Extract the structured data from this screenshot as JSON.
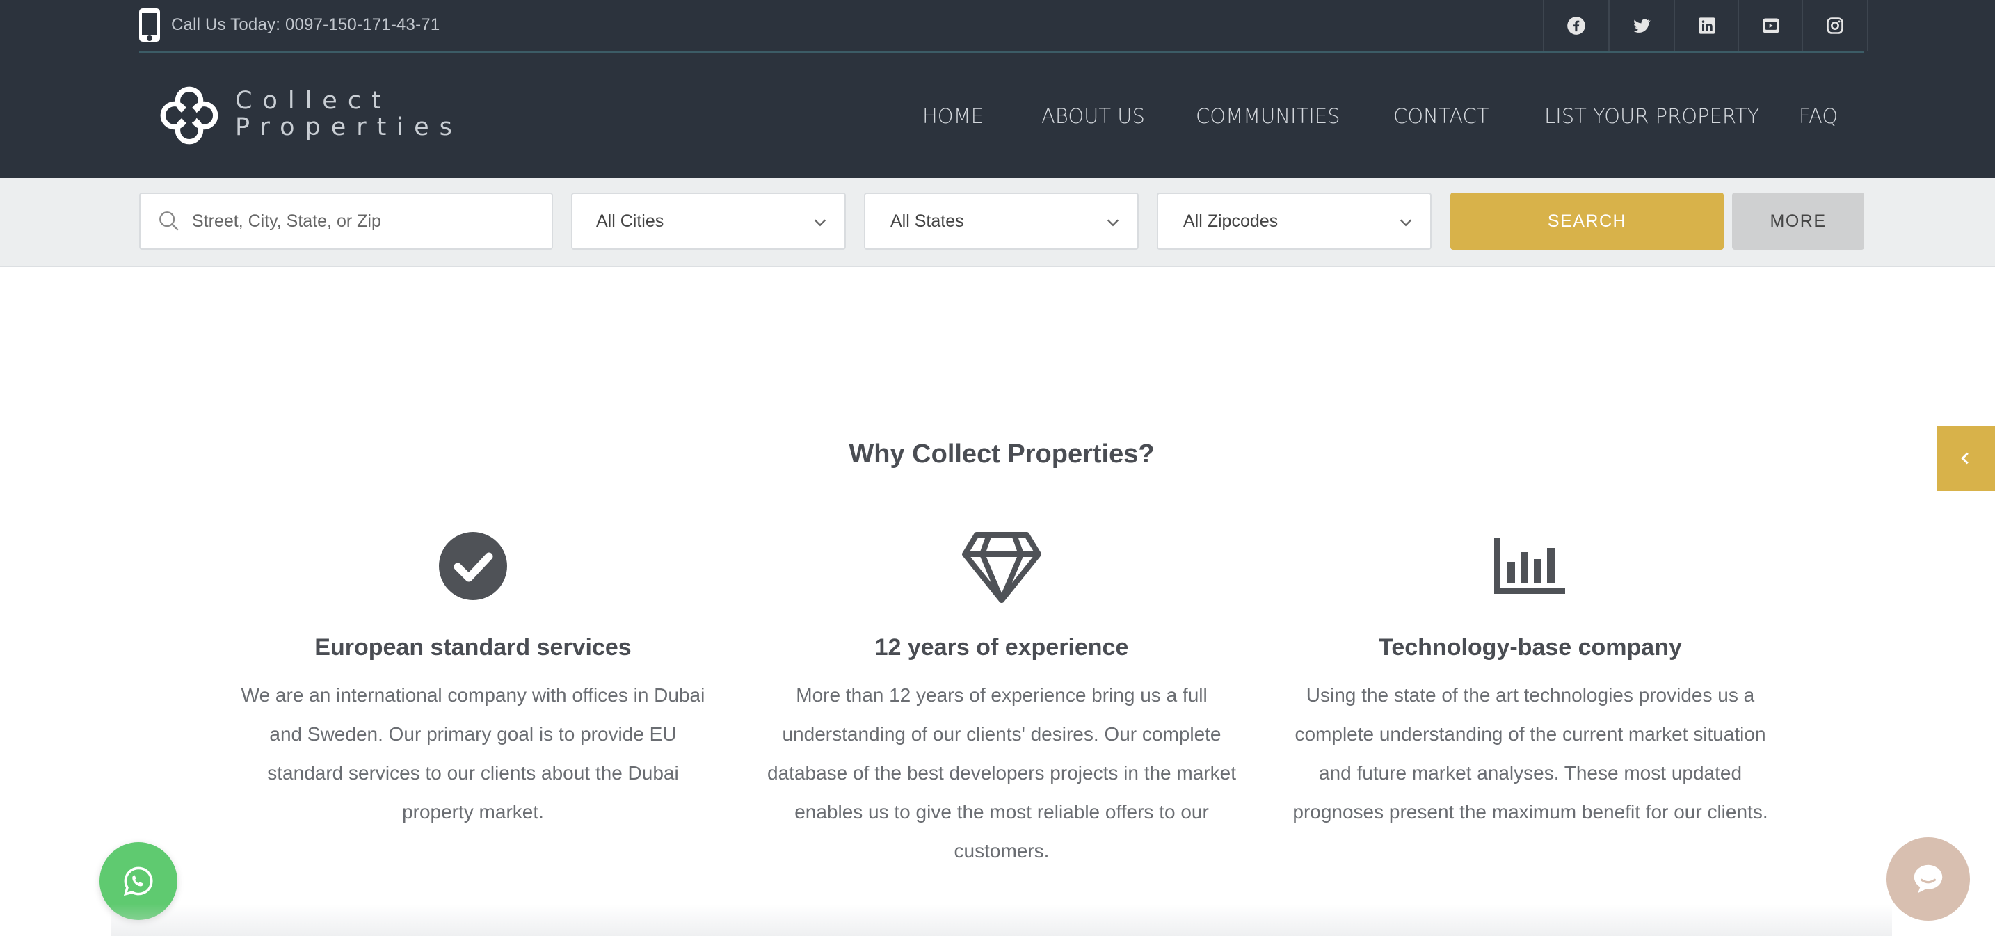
{
  "topbar": {
    "call_text": "Call Us Today: 0097-150-171-43-71",
    "phone_icon": "mobile-phone-icon",
    "social": [
      {
        "name": "facebook-icon"
      },
      {
        "name": "twitter-icon"
      },
      {
        "name": "linkedin-icon"
      },
      {
        "name": "youtube-icon"
      },
      {
        "name": "instagram-icon"
      }
    ]
  },
  "brand": {
    "line1": "Collect",
    "line2": "Properties"
  },
  "nav": {
    "items": [
      "HOME",
      "ABOUT US",
      "COMMUNITIES",
      "CONTACT",
      "LIST YOUR PROPERTY",
      "FAQ"
    ]
  },
  "search": {
    "placeholder": "Street, City, State, or Zip",
    "city_select": "All Cities",
    "state_select": "All States",
    "zip_select": "All Zipcodes",
    "search_button": "SEARCH",
    "more_button": "MORE"
  },
  "section": {
    "title": "Why Collect Properties?",
    "features": [
      {
        "icon": "check-circle-icon",
        "title": "European standard services",
        "text": "We are an international company with offices in Dubai and Sweden. Our primary goal is to provide EU standard services to our clients about the Dubai property market."
      },
      {
        "icon": "diamond-icon",
        "title": "12 years of experience",
        "text": "More than 12 years of experience bring us a full understanding of our clients' desires. Our complete database of the best developers projects in the market enables us to give the most reliable offers to our customers."
      },
      {
        "icon": "bar-chart-icon",
        "title": "Technology-base company",
        "text": "Using the state of the art technologies provides us a complete understanding of the current market situation and future market analyses. These most updated prognoses present the maximum benefit for our clients."
      }
    ]
  },
  "colors": {
    "header_bg": "#2c333d",
    "accent": "#d8b24a",
    "whatsapp": "#5fca70",
    "chat": "#d8bfb0"
  }
}
